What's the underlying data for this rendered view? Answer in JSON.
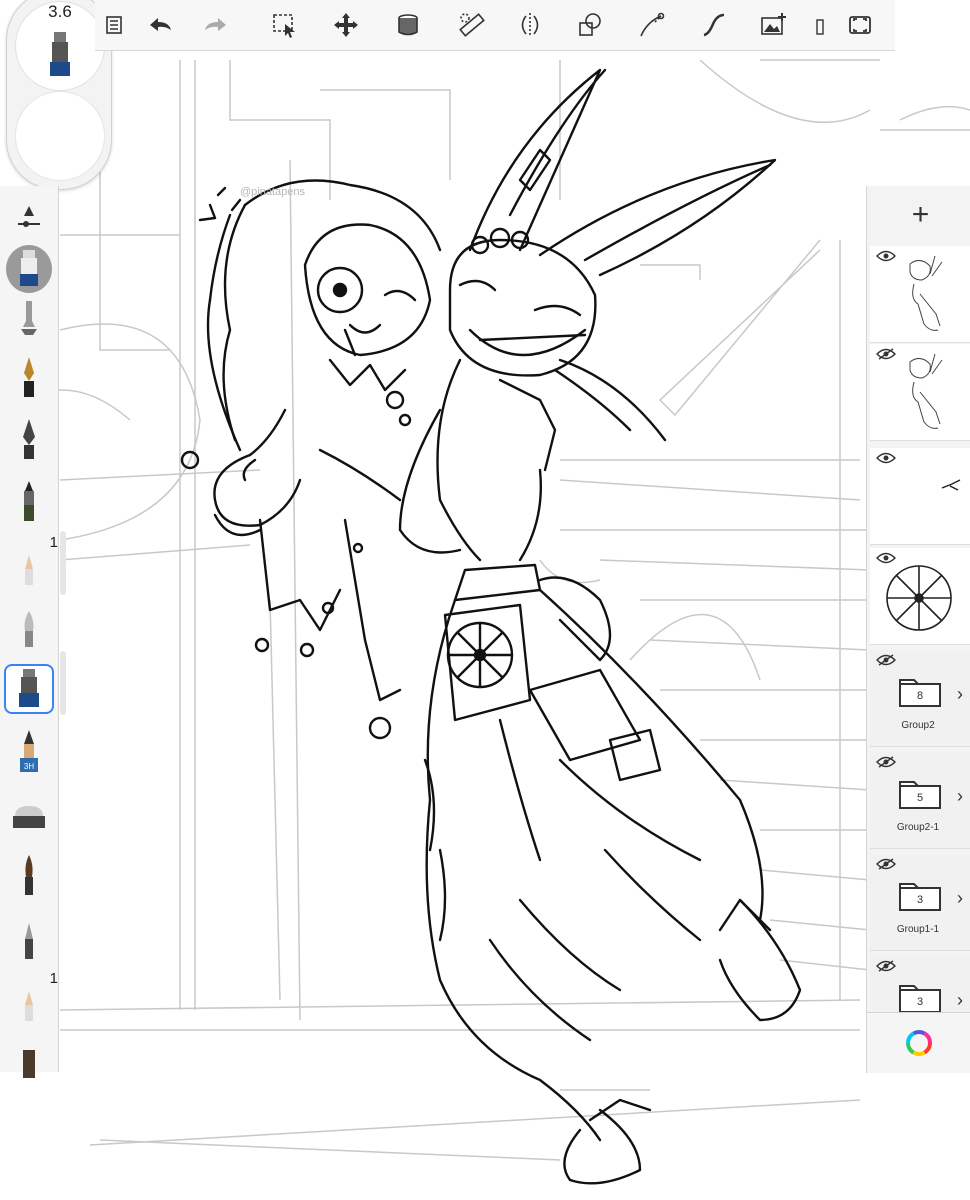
{
  "brush_puck": {
    "size_value": "3.6"
  },
  "toolbar": {
    "icons": [
      "layers-menu-icon",
      "undo-icon",
      "redo-icon",
      "selection-icon",
      "transform-icon",
      "fill-icon",
      "ruler-icon",
      "symmetry-icon",
      "shapes-icon",
      "curve-icon",
      "stroke-icon",
      "image-import-icon",
      "text-icon",
      "fullscreen-icon"
    ]
  },
  "brush_palette": {
    "items": [
      {
        "icon": "brush-size-slider-icon",
        "badge": ""
      },
      {
        "icon": "opacity-brush-icon",
        "badge": ""
      },
      {
        "icon": "airbrush-icon",
        "badge": ""
      },
      {
        "icon": "ballpoint-pen-icon",
        "badge": ""
      },
      {
        "icon": "ink-pen-icon",
        "badge": ""
      },
      {
        "icon": "marker-icon",
        "badge": ""
      },
      {
        "icon": "pencil-icon",
        "badge": "1"
      },
      {
        "icon": "soft-brush-icon",
        "badge": ""
      },
      {
        "icon": "chisel-marker-icon",
        "badge": ""
      },
      {
        "icon": "pencil-3h-icon",
        "badge": ""
      },
      {
        "icon": "eraser-icon",
        "badge": ""
      },
      {
        "icon": "paintbrush-icon",
        "badge": ""
      },
      {
        "icon": "smudge-icon",
        "badge": ""
      },
      {
        "icon": "pencil-icon",
        "badge": "1"
      },
      {
        "icon": "flat-brush-icon",
        "badge": ""
      }
    ],
    "selected_index": 8
  },
  "layers_panel": {
    "add_label": "+",
    "layers": [
      {
        "type": "image",
        "visible": true,
        "thumbnail": "character-sketch"
      },
      {
        "type": "image",
        "visible": false,
        "thumbnail": "character-sketch"
      },
      {
        "type": "image",
        "visible": true,
        "thumbnail": "small-stroke"
      },
      {
        "type": "image",
        "visible": true,
        "thumbnail": "flower-pattern"
      }
    ],
    "groups": [
      {
        "name": "Group2",
        "count": "8",
        "visible": false
      },
      {
        "name": "Group2-1",
        "count": "5",
        "visible": false
      },
      {
        "name": "Group1-1",
        "count": "3",
        "visible": false
      },
      {
        "name": "",
        "count": "3",
        "visible": false
      }
    ]
  },
  "canvas": {
    "description_watermark": "@pinatapens",
    "accent_color": "#3b82f6"
  }
}
